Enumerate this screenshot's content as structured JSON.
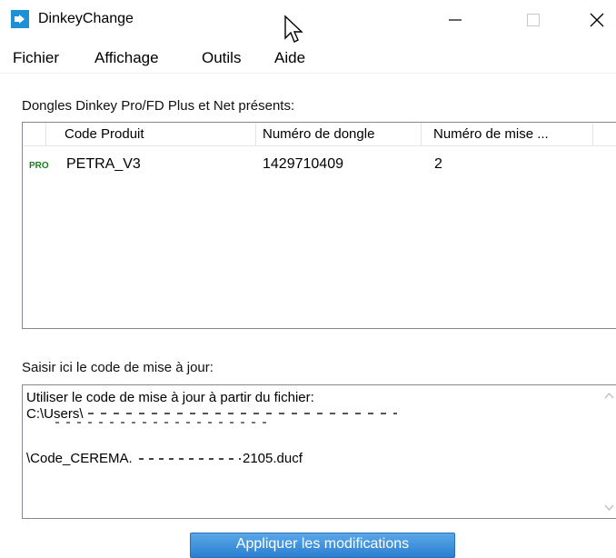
{
  "window": {
    "title": "DinkeyChange",
    "icons": [
      "app-icon",
      "minimize-icon",
      "maximize-icon",
      "close-icon",
      "cursor-icon"
    ]
  },
  "menu": [
    "Fichier",
    "Affichage",
    "Outils",
    "Aide"
  ],
  "dongles_label": "Dongles Dinkey Pro/FD Plus et Net présents:",
  "table": {
    "columns": [
      "Code Produit",
      "Numéro de dongle",
      "Numéro de mise ..."
    ],
    "rows": [
      {
        "badge": "PRO",
        "product_code": "PETRA_V3",
        "dongle_number": "1429710409",
        "update_number": "2"
      }
    ]
  },
  "update_code_label": "Saisir ici le code de mise à jour:",
  "update_code": {
    "line1": "Utiliser le code de mise à jour à partir du fichier:",
    "line2": "C:\\Users\\",
    "line3": "\\Code_CEREMA.",
    "line3_end": "2105.ducf"
  },
  "apply_button": "Appliquer les modifications",
  "colors": {
    "pro_badge": "#1a7f1a",
    "button": "#2b7fd0",
    "app_icon": "#1e90d6"
  }
}
